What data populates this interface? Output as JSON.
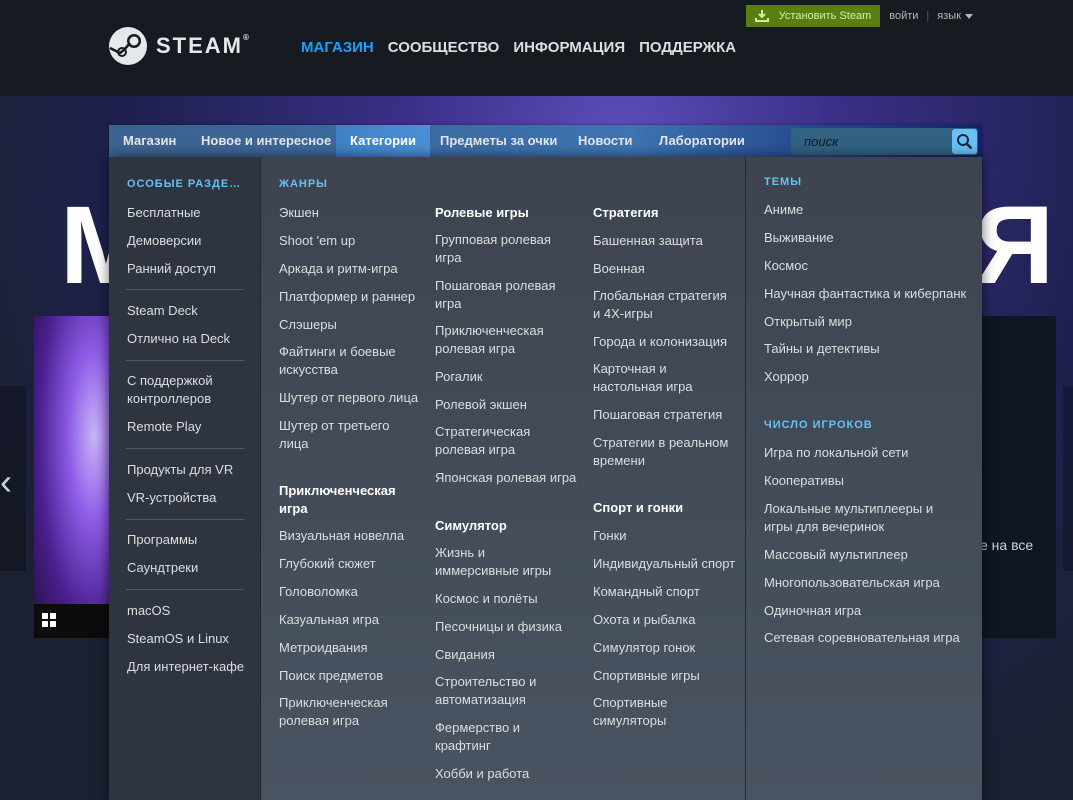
{
  "header": {
    "logo_text": "STEAM",
    "logo_reg": "®",
    "nav": [
      "МАГАЗИН",
      "СООБЩЕСТВО",
      "ИНФОРМАЦИЯ",
      "ПОДДЕРЖКА"
    ],
    "install_label": "Установить Steam",
    "login_label": "войти",
    "separator": "|",
    "language_label": "язык"
  },
  "hero": {
    "big_text_left": "M",
    "big_text_right": "Я",
    "side_text": "е на все",
    "arrow": "‹"
  },
  "store_nav": {
    "tabs": [
      "Магазин",
      "Новое и интересное",
      "Категории",
      "Предметы за очки",
      "Новости",
      "Лаборатории"
    ],
    "active_tab": "Категории",
    "search_placeholder": "поиск"
  },
  "dropdown": {
    "special": {
      "header": "ОСОБЫЕ РАЗДЕ…",
      "items": [
        "Бесплатные",
        "Демоверсии",
        "Ранний доступ",
        "Steam Deck",
        "Отлично на Deck",
        "С поддержкой контроллеров",
        "Remote Play",
        "Продукты для VR",
        "VR-устройства",
        "Программы",
        "Саундтреки",
        "macOS",
        "SteamOS и Linux",
        "Для интернет-кафе"
      ]
    },
    "genres": {
      "header": "ЖАНРЫ",
      "col1": [
        "Экшен",
        "Shoot 'em up",
        "Аркада и ритм-игра",
        "Платформер и раннер",
        "Слэшеры",
        "Файтинги и боевые искусства",
        "Шутер от первого лица",
        "Шутер от третьего лица"
      ],
      "adventure_header": "Приключенческая игра",
      "col1b": [
        "Визуальная новелла",
        "Глубокий сюжет",
        "Головоломка",
        "Казуальная игра",
        "Метроидвания",
        "Поиск предметов",
        "Приключенческая ролевая игра"
      ],
      "rpg_header": "Ролевые игры",
      "col2": [
        "Групповая ролевая игра",
        "Пошаговая ролевая игра",
        "Приключенческая ролевая игра",
        "Рогалик",
        "Ролевой экшен",
        "Стратегическая ролевая игра",
        "Японская ролевая игра"
      ],
      "sim_header": "Симулятор",
      "col2b": [
        "Жизнь и иммерсивные игры",
        "Космос и полёты",
        "Песочницы и физика",
        "Свидания",
        "Строительство и автоматизация",
        "Фермерство и крафтинг",
        "Хобби и работа"
      ],
      "strategy_header": "Стратегия",
      "col3": [
        "Башенная защита",
        "Военная",
        "Глобальная стратегия и 4X-игры",
        "Города и колонизация",
        "Карточная и настольная игра",
        "Пошаговая стратегия",
        "Стратегии в реальном времени"
      ],
      "sports_header": "Спорт и гонки",
      "col3b": [
        "Гонки",
        "Индивидуальный спорт",
        "Командный спорт",
        "Охота и рыбалка",
        "Симулятор гонок",
        "Спортивные игры",
        "Спортивные симуляторы"
      ]
    },
    "themes": {
      "header": "ТЕМЫ",
      "items": [
        "Аниме",
        "Выживание",
        "Космос",
        "Научная фантастика и киберпанк",
        "Открытый мир",
        "Тайны и детективы",
        "Хоррор"
      ],
      "players_header": "ЧИСЛО ИГРОКОВ",
      "players": [
        "Игра по локальной сети",
        "Кооперативы",
        "Локальные мультиплееры и игры для вечеринок",
        "Массовый мультиплеер",
        "Многопользовательская игра",
        "Одиночная игра",
        "Сетевая соревновательная игра"
      ]
    }
  },
  "colors": {
    "accent": "#67c1f5",
    "active_nav": "#1a9fff",
    "install_bg": "#5c7e10"
  }
}
